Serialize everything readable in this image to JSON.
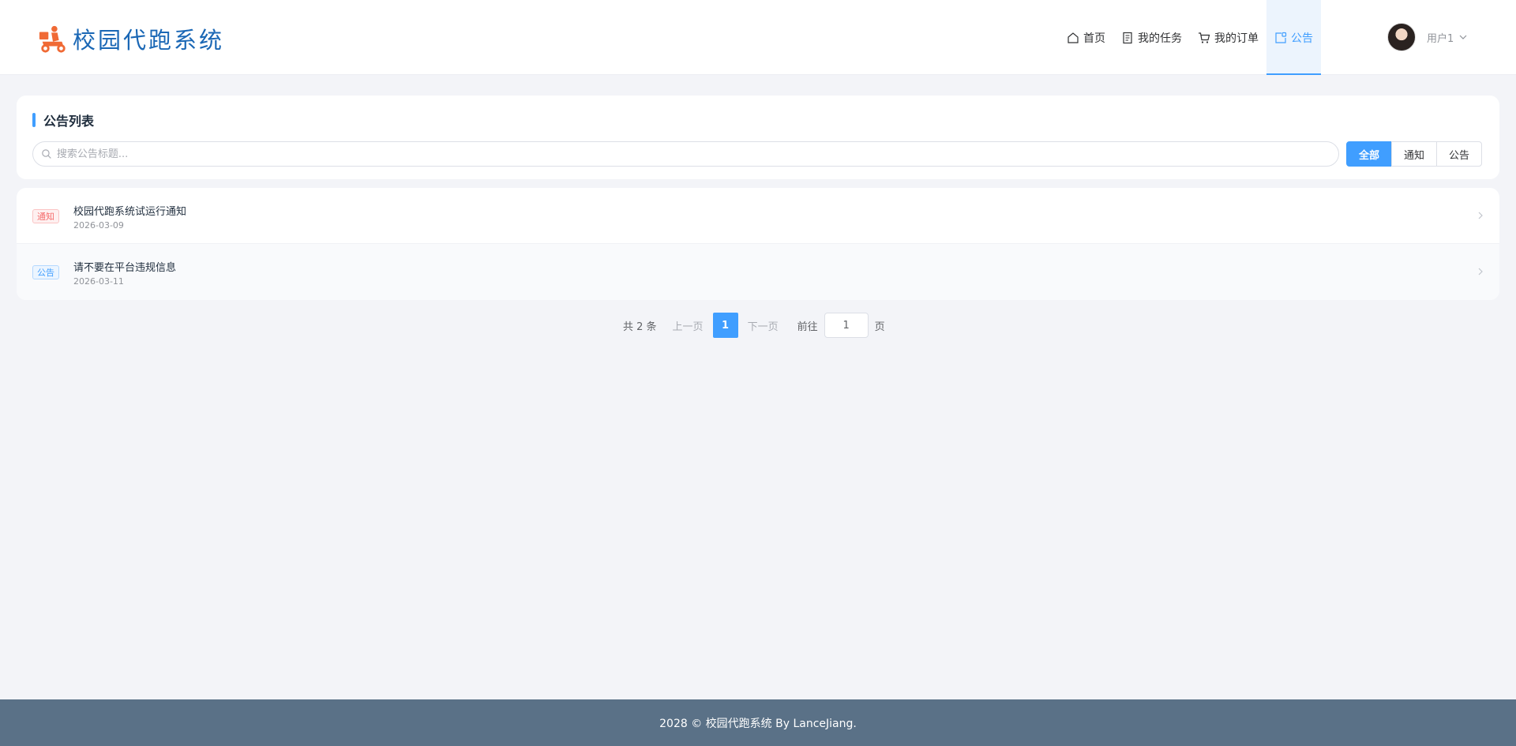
{
  "header": {
    "app_title": "校园代跑系统",
    "nav": [
      {
        "label": "首页",
        "icon": "home-icon"
      },
      {
        "label": "我的任务",
        "icon": "document-icon"
      },
      {
        "label": "我的订单",
        "icon": "cart-icon"
      },
      {
        "label": "公告",
        "icon": "announcement-icon",
        "active": true
      }
    ],
    "user_name": "用户1"
  },
  "announcements": {
    "title": "公告列表",
    "search_placeholder": "搜索公告标题...",
    "filters": [
      {
        "label": "全部",
        "active": true
      },
      {
        "label": "通知",
        "active": false
      },
      {
        "label": "公告",
        "active": false
      }
    ],
    "items": [
      {
        "tag": "通知",
        "tag_type": "notice",
        "title": "校园代跑系统试运行通知",
        "date": "2026-03-09"
      },
      {
        "tag": "公告",
        "tag_type": "announce",
        "title": "请不要在平台违规信息",
        "date": "2026-03-11"
      }
    ]
  },
  "pagination": {
    "total_label": "共 2 条",
    "prev_label": "上一页",
    "current_page": "1",
    "next_label": "下一页",
    "goto_label": "前往",
    "goto_value": "1",
    "unit_label": "页"
  },
  "footer": {
    "text": "2028 © 校园代跑系统 By LanceJiang."
  },
  "colors": {
    "primary": "#409eff",
    "logo_text": "#1a67b5",
    "logo_icon": "#f06a35",
    "footer_bg": "#5a7187",
    "notice_tag": "#f56c6c"
  }
}
